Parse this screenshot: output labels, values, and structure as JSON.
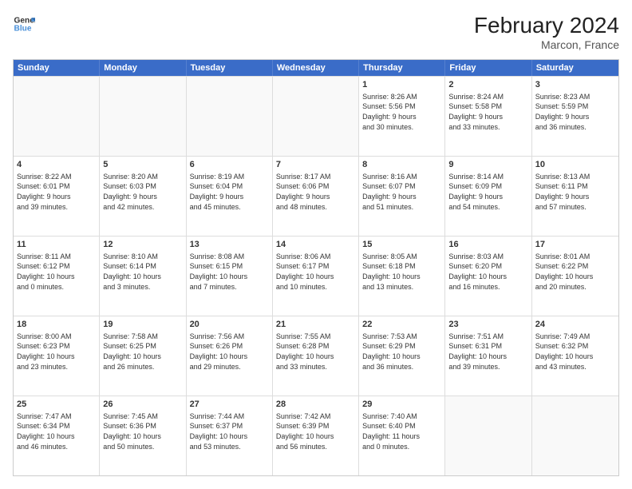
{
  "header": {
    "logo": {
      "line1": "General",
      "line2": "Blue"
    },
    "title": "February 2024",
    "subtitle": "Marcon, France"
  },
  "weekdays": [
    "Sunday",
    "Monday",
    "Tuesday",
    "Wednesday",
    "Thursday",
    "Friday",
    "Saturday"
  ],
  "rows": [
    [
      {
        "day": "",
        "info": ""
      },
      {
        "day": "",
        "info": ""
      },
      {
        "day": "",
        "info": ""
      },
      {
        "day": "",
        "info": ""
      },
      {
        "day": "1",
        "info": "Sunrise: 8:26 AM\nSunset: 5:56 PM\nDaylight: 9 hours\nand 30 minutes."
      },
      {
        "day": "2",
        "info": "Sunrise: 8:24 AM\nSunset: 5:58 PM\nDaylight: 9 hours\nand 33 minutes."
      },
      {
        "day": "3",
        "info": "Sunrise: 8:23 AM\nSunset: 5:59 PM\nDaylight: 9 hours\nand 36 minutes."
      }
    ],
    [
      {
        "day": "4",
        "info": "Sunrise: 8:22 AM\nSunset: 6:01 PM\nDaylight: 9 hours\nand 39 minutes."
      },
      {
        "day": "5",
        "info": "Sunrise: 8:20 AM\nSunset: 6:03 PM\nDaylight: 9 hours\nand 42 minutes."
      },
      {
        "day": "6",
        "info": "Sunrise: 8:19 AM\nSunset: 6:04 PM\nDaylight: 9 hours\nand 45 minutes."
      },
      {
        "day": "7",
        "info": "Sunrise: 8:17 AM\nSunset: 6:06 PM\nDaylight: 9 hours\nand 48 minutes."
      },
      {
        "day": "8",
        "info": "Sunrise: 8:16 AM\nSunset: 6:07 PM\nDaylight: 9 hours\nand 51 minutes."
      },
      {
        "day": "9",
        "info": "Sunrise: 8:14 AM\nSunset: 6:09 PM\nDaylight: 9 hours\nand 54 minutes."
      },
      {
        "day": "10",
        "info": "Sunrise: 8:13 AM\nSunset: 6:11 PM\nDaylight: 9 hours\nand 57 minutes."
      }
    ],
    [
      {
        "day": "11",
        "info": "Sunrise: 8:11 AM\nSunset: 6:12 PM\nDaylight: 10 hours\nand 0 minutes."
      },
      {
        "day": "12",
        "info": "Sunrise: 8:10 AM\nSunset: 6:14 PM\nDaylight: 10 hours\nand 3 minutes."
      },
      {
        "day": "13",
        "info": "Sunrise: 8:08 AM\nSunset: 6:15 PM\nDaylight: 10 hours\nand 7 minutes."
      },
      {
        "day": "14",
        "info": "Sunrise: 8:06 AM\nSunset: 6:17 PM\nDaylight: 10 hours\nand 10 minutes."
      },
      {
        "day": "15",
        "info": "Sunrise: 8:05 AM\nSunset: 6:18 PM\nDaylight: 10 hours\nand 13 minutes."
      },
      {
        "day": "16",
        "info": "Sunrise: 8:03 AM\nSunset: 6:20 PM\nDaylight: 10 hours\nand 16 minutes."
      },
      {
        "day": "17",
        "info": "Sunrise: 8:01 AM\nSunset: 6:22 PM\nDaylight: 10 hours\nand 20 minutes."
      }
    ],
    [
      {
        "day": "18",
        "info": "Sunrise: 8:00 AM\nSunset: 6:23 PM\nDaylight: 10 hours\nand 23 minutes."
      },
      {
        "day": "19",
        "info": "Sunrise: 7:58 AM\nSunset: 6:25 PM\nDaylight: 10 hours\nand 26 minutes."
      },
      {
        "day": "20",
        "info": "Sunrise: 7:56 AM\nSunset: 6:26 PM\nDaylight: 10 hours\nand 29 minutes."
      },
      {
        "day": "21",
        "info": "Sunrise: 7:55 AM\nSunset: 6:28 PM\nDaylight: 10 hours\nand 33 minutes."
      },
      {
        "day": "22",
        "info": "Sunrise: 7:53 AM\nSunset: 6:29 PM\nDaylight: 10 hours\nand 36 minutes."
      },
      {
        "day": "23",
        "info": "Sunrise: 7:51 AM\nSunset: 6:31 PM\nDaylight: 10 hours\nand 39 minutes."
      },
      {
        "day": "24",
        "info": "Sunrise: 7:49 AM\nSunset: 6:32 PM\nDaylight: 10 hours\nand 43 minutes."
      }
    ],
    [
      {
        "day": "25",
        "info": "Sunrise: 7:47 AM\nSunset: 6:34 PM\nDaylight: 10 hours\nand 46 minutes."
      },
      {
        "day": "26",
        "info": "Sunrise: 7:45 AM\nSunset: 6:36 PM\nDaylight: 10 hours\nand 50 minutes."
      },
      {
        "day": "27",
        "info": "Sunrise: 7:44 AM\nSunset: 6:37 PM\nDaylight: 10 hours\nand 53 minutes."
      },
      {
        "day": "28",
        "info": "Sunrise: 7:42 AM\nSunset: 6:39 PM\nDaylight: 10 hours\nand 56 minutes."
      },
      {
        "day": "29",
        "info": "Sunrise: 7:40 AM\nSunset: 6:40 PM\nDaylight: 11 hours\nand 0 minutes."
      },
      {
        "day": "",
        "info": ""
      },
      {
        "day": "",
        "info": ""
      }
    ]
  ]
}
